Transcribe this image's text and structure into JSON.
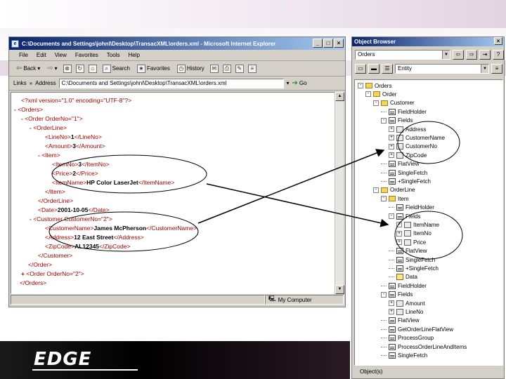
{
  "ie": {
    "title": "C:\\Documents and Settings\\johnl\\Desktop\\TransacXML\\orders.xml - Microsoft Internet Explorer",
    "menu": [
      "File",
      "Edit",
      "View",
      "Favorites",
      "Tools",
      "Help"
    ],
    "toolbar": {
      "back": "Back",
      "search": "Search",
      "favorites": "Favorites",
      "history": "History"
    },
    "links_label": "Links",
    "address_label": "Address",
    "address_value": "C:\\Documents and Settings\\johnl\\Desktop\\TransacXML\\orders.xml",
    "go_label": "Go",
    "status_zone": "My Computer"
  },
  "xml_lines": [
    {
      "mark": "",
      "text": "<?xml version=\"1.0\" encoding=\"UTF-8\"?>",
      "value": "",
      "close": ""
    },
    {
      "mark": "-",
      "text": "<Orders>",
      "value": "",
      "close": ""
    },
    {
      "mark": "-",
      "text": "<Order OrderNo=\"1\">",
      "value": "",
      "close": ""
    },
    {
      "mark": "-",
      "text": "<OrderLine>",
      "value": "",
      "close": ""
    },
    {
      "mark": "",
      "text": "<LineNo>",
      "value": "1",
      "close": "</LineNo>"
    },
    {
      "mark": "",
      "text": "<Amount>",
      "value": "3",
      "close": "</Amount>"
    },
    {
      "mark": "-",
      "text": "<Item>",
      "value": "",
      "close": ""
    },
    {
      "mark": "",
      "text": "<ItemNo>",
      "value": "3",
      "close": "</ItemNo>"
    },
    {
      "mark": "",
      "text": "<Price>",
      "value": "2",
      "close": "</Price>"
    },
    {
      "mark": "",
      "text": "<ItemName>",
      "value": "HP Color LaserJet",
      "close": "</ItemName>"
    },
    {
      "mark": "",
      "text": "</Item>",
      "value": "",
      "close": ""
    },
    {
      "mark": "",
      "text": "</OrderLine>",
      "value": "",
      "close": ""
    },
    {
      "mark": "",
      "text": "<Date>",
      "value": "2001-10-05",
      "close": "</Date>"
    },
    {
      "mark": "-",
      "text": "<Customer CustomerNo=\"2\">",
      "value": "",
      "close": ""
    },
    {
      "mark": "",
      "text": "<CustomerName>",
      "value": "James McPherson",
      "close": "</CustomerName>"
    },
    {
      "mark": "",
      "text": "<Address>",
      "value": "12 East Street",
      "close": "</Address>"
    },
    {
      "mark": "",
      "text": "<ZipCode>",
      "value": "AL12345",
      "close": "</ZipCode>"
    },
    {
      "mark": "",
      "text": "</Customer>",
      "value": "",
      "close": ""
    },
    {
      "mark": "",
      "text": "</Order>",
      "value": "",
      "close": ""
    },
    {
      "mark": "+",
      "text": "<Order OrderNo=\"2\">",
      "value": "",
      "close": ""
    },
    {
      "mark": "",
      "text": "</Orders>",
      "value": "",
      "close": ""
    }
  ],
  "ob": {
    "title": "Object Browser",
    "selected_object": "Orders",
    "filter_value": "Entity",
    "status": "Object(s)",
    "tree": [
      {
        "label": "Orders",
        "pm": "-",
        "icon": "folder"
      },
      {
        "label": "Order",
        "pm": "-",
        "icon": "folder"
      },
      {
        "label": "Customer",
        "pm": "-",
        "icon": "folder"
      },
      {
        "label": "FieldHolder",
        "pm": "",
        "icon": "list"
      },
      {
        "label": "Fields",
        "pm": "-",
        "icon": "list"
      },
      {
        "label": "Address",
        "pm": "+",
        "icon": "item"
      },
      {
        "label": "CustomerName",
        "pm": "+",
        "icon": "item"
      },
      {
        "label": "CustomerNo",
        "pm": "+",
        "icon": "item"
      },
      {
        "label": "ZipCode",
        "pm": "+",
        "icon": "item"
      },
      {
        "label": "FlatView",
        "pm": "",
        "icon": "list"
      },
      {
        "label": "SingleFetch",
        "pm": "",
        "icon": "list"
      },
      {
        "label": "+SingleFetch",
        "pm": "",
        "icon": "list"
      },
      {
        "label": "OrderLine",
        "pm": "-",
        "icon": "folder"
      },
      {
        "label": "Item",
        "pm": "-",
        "icon": "folder"
      },
      {
        "label": "FieldHolder",
        "pm": "",
        "icon": "list"
      },
      {
        "label": "Fields",
        "pm": "-",
        "icon": "list"
      },
      {
        "label": "ItemName",
        "pm": "+",
        "icon": "item"
      },
      {
        "label": "ItemNo",
        "pm": "+",
        "icon": "item"
      },
      {
        "label": "Price",
        "pm": "+",
        "icon": "item"
      },
      {
        "label": "FlatView",
        "pm": "",
        "icon": "list"
      },
      {
        "label": "SingleFetch",
        "pm": "",
        "icon": "list"
      },
      {
        "label": "+SingleFetch",
        "pm": "",
        "icon": "list"
      },
      {
        "label": "Data",
        "pm": "",
        "icon": "data"
      },
      {
        "label": "FieldHolder",
        "pm": "",
        "icon": "list"
      },
      {
        "label": "Fields",
        "pm": "-",
        "icon": "list"
      },
      {
        "label": "Amount",
        "pm": "+",
        "icon": "item"
      },
      {
        "label": "LineNo",
        "pm": "+",
        "icon": "item"
      },
      {
        "label": "FlatView",
        "pm": "",
        "icon": "list"
      },
      {
        "label": "GetOrderLineFlatView",
        "pm": "",
        "icon": "list"
      },
      {
        "label": "ProcessGroup",
        "pm": "",
        "icon": "list"
      },
      {
        "label": "ProcessOrderLineAndItems",
        "pm": "",
        "icon": "list"
      },
      {
        "label": "SingleFetch",
        "pm": "",
        "icon": "list"
      }
    ]
  },
  "footer": {
    "logo": "EDGE"
  },
  "colors": {
    "markup": "#a00000",
    "titlebar": "#0a246a",
    "window": "#d4d0c8"
  }
}
